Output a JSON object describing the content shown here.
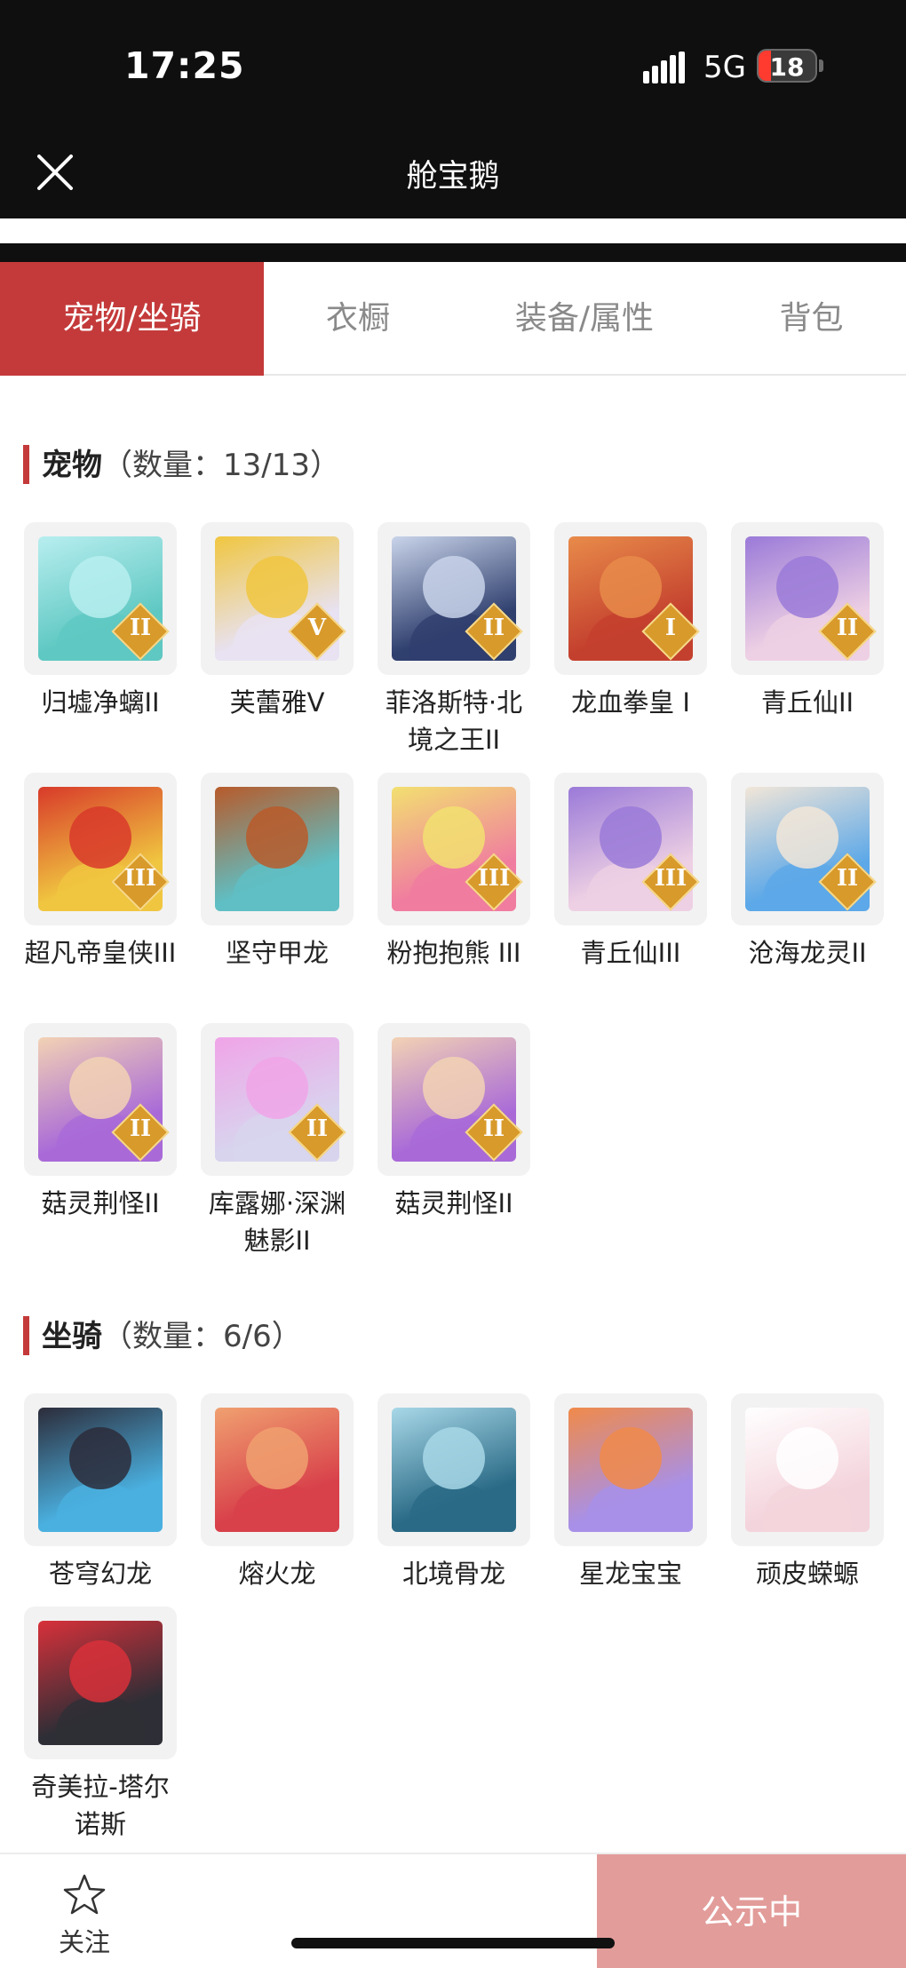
{
  "status_bar": {
    "time": "17:25",
    "network": "5G",
    "battery": "18"
  },
  "header": {
    "title": "舱宝鹅"
  },
  "tabs": [
    {
      "label": "宠物/坐骑",
      "active": true
    },
    {
      "label": "衣橱",
      "active": false
    },
    {
      "label": "装备/属性",
      "active": false
    },
    {
      "label": "背包",
      "active": false
    }
  ],
  "pets": {
    "title": "宠物",
    "count": "（数量：13/13）",
    "items": [
      {
        "name": "归墟净螭II",
        "rank": "II",
        "color": "#5fc8c2",
        "accent": "#b8eef0"
      },
      {
        "name": "芙蕾雅V",
        "rank": "V",
        "color": "#e8e2f2",
        "accent": "#f0c640"
      },
      {
        "name": "菲洛斯特·北境之王II",
        "rank": "II",
        "color": "#2f3f6e",
        "accent": "#c9d4ea"
      },
      {
        "name": "龙血拳皇 I",
        "rank": "I",
        "color": "#c4402e",
        "accent": "#e88b4a"
      },
      {
        "name": "青丘仙II",
        "rank": "II",
        "color": "#eed0e4",
        "accent": "#9a7ad8"
      },
      {
        "name": "超凡帝皇侠III",
        "rank": "III",
        "color": "#f0c640",
        "accent": "#d83a2a"
      },
      {
        "name": "坚守甲龙",
        "rank": "",
        "color": "#5fbfc4",
        "accent": "#b85a2a"
      },
      {
        "name": "粉抱抱熊 III",
        "rank": "III",
        "color": "#f07ca0",
        "accent": "#f2e070"
      },
      {
        "name": "青丘仙III",
        "rank": "III",
        "color": "#eed0e4",
        "accent": "#9a7ad8"
      },
      {
        "name": "沧海龙灵II",
        "rank": "II",
        "color": "#5ca8e8",
        "accent": "#f2e6d8"
      },
      {
        "name": "菇灵荆怪II",
        "rank": "II",
        "color": "#a96ad8",
        "accent": "#f2d2b4"
      },
      {
        "name": "库露娜·深渊魅影II",
        "rank": "II",
        "color": "#d8d4ee",
        "accent": "#f0a4e8"
      },
      {
        "name": "菇灵荆怪II",
        "rank": "II",
        "color": "#a96ad8",
        "accent": "#f2d2b4"
      }
    ]
  },
  "mounts": {
    "title": "坐骑",
    "count": "（数量：6/6）",
    "items": [
      {
        "name": "苍穹幻龙",
        "color": "#4ab0e0",
        "accent": "#2c2c3a"
      },
      {
        "name": "熔火龙",
        "color": "#d8404a",
        "accent": "#f0a070"
      },
      {
        "name": "北境骨龙",
        "color": "#2a6a86",
        "accent": "#a8d8e8"
      },
      {
        "name": "星龙宝宝",
        "color": "#a890e8",
        "accent": "#f08a4a"
      },
      {
        "name": "顽皮蝾螈",
        "color": "#f4d4dc",
        "accent": "#ffffff"
      },
      {
        "name": "奇美拉-塔尔诺斯",
        "color": "#2e2e36",
        "accent": "#d8303a"
      }
    ]
  },
  "bottom": {
    "follow_label": "关注",
    "status_label": "公示中"
  }
}
